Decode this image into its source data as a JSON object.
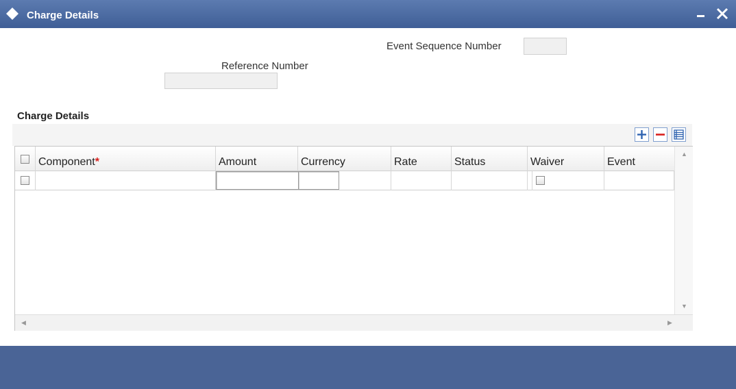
{
  "window": {
    "title": "Charge Details",
    "icon": "diamond-icon",
    "controls": [
      "minimize-icon",
      "close-icon"
    ]
  },
  "form": {
    "event_sequence_number": {
      "label": "Event Sequence Number",
      "value": ""
    },
    "reference_number": {
      "label": "Reference Number",
      "value": ""
    }
  },
  "section": {
    "title": "Charge Details",
    "toolbar": [
      "add-row-icon",
      "delete-row-icon",
      "view-details-icon"
    ]
  },
  "grid": {
    "columns": [
      {
        "label": "Component",
        "required": true
      },
      {
        "label": "Amount"
      },
      {
        "label": "Currency"
      },
      {
        "label": "Rate"
      },
      {
        "label": "Status"
      },
      {
        "label": "Waiver"
      },
      {
        "label": "Event"
      }
    ],
    "required_marker": "*",
    "rows": [
      {
        "component": "",
        "amount": "",
        "currency": "",
        "rate": "",
        "status": "",
        "waiver": false,
        "event": ""
      }
    ]
  },
  "colors": {
    "titlebar": "#4a6aa3",
    "footer": "#4a6496",
    "accent_blue": "#2f63b0",
    "required_red": "#d8201d"
  }
}
